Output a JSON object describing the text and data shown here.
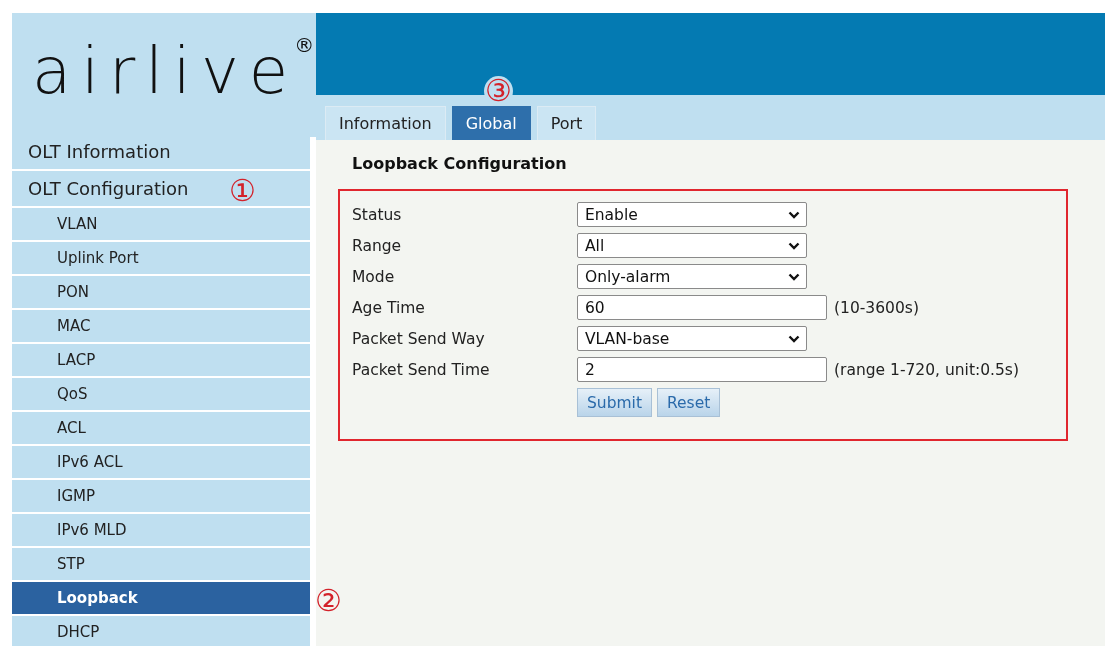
{
  "logo": {
    "text": "airlive",
    "mark": "®"
  },
  "tabs": [
    {
      "label": "Information",
      "selected": false
    },
    {
      "label": "Global",
      "selected": true
    },
    {
      "label": "Port",
      "selected": false
    }
  ],
  "sidebar": {
    "items": [
      {
        "label": "OLT Information",
        "selected": false
      },
      {
        "label": "OLT Configuration",
        "selected": false,
        "children": [
          {
            "label": "VLAN",
            "selected": false
          },
          {
            "label": "Uplink Port",
            "selected": false
          },
          {
            "label": "PON",
            "selected": false
          },
          {
            "label": "MAC",
            "selected": false
          },
          {
            "label": "LACP",
            "selected": false
          },
          {
            "label": "QoS",
            "selected": false
          },
          {
            "label": "ACL",
            "selected": false
          },
          {
            "label": "IPv6 ACL",
            "selected": false
          },
          {
            "label": "IGMP",
            "selected": false
          },
          {
            "label": "IPv6 MLD",
            "selected": false
          },
          {
            "label": "STP",
            "selected": false
          },
          {
            "label": "Loopback",
            "selected": true
          },
          {
            "label": "DHCP",
            "selected": false
          }
        ]
      }
    ]
  },
  "form": {
    "title": "Loopback Configuration",
    "fields": [
      {
        "kind": "select",
        "label": "Status",
        "value": "Enable"
      },
      {
        "kind": "select",
        "label": "Range",
        "value": "All"
      },
      {
        "kind": "select",
        "label": "Mode",
        "value": "Only-alarm"
      },
      {
        "kind": "input",
        "label": "Age Time",
        "value": "60",
        "hint": "(10-3600s)"
      },
      {
        "kind": "select",
        "label": "Packet Send Way",
        "value": "VLAN-base"
      },
      {
        "kind": "input",
        "label": "Packet Send Time",
        "value": "2",
        "hint": "(range 1-720, unit:0.5s)"
      }
    ],
    "buttons": [
      "Submit",
      "Reset"
    ]
  },
  "annotations": [
    "①",
    "②",
    "③"
  ]
}
